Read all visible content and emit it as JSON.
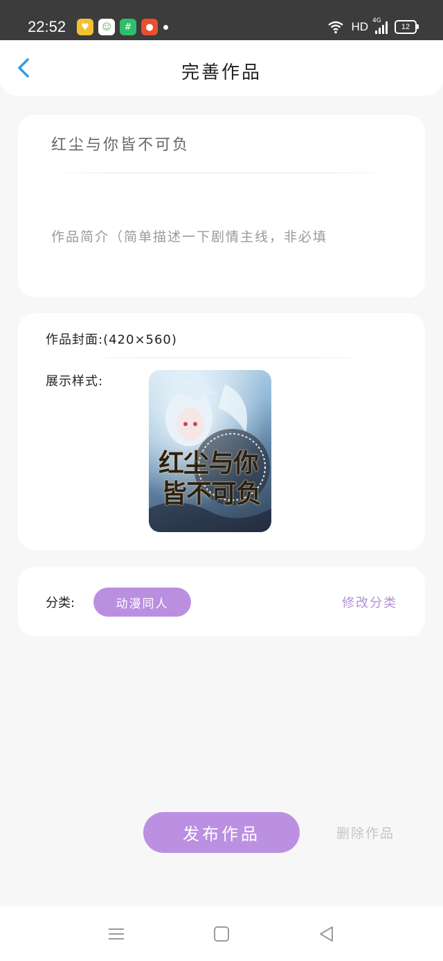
{
  "status_bar": {
    "time": "22:52",
    "network": "HD",
    "cell": "4G",
    "battery": "12",
    "app_icons": [
      "notes-app-icon",
      "chat-app-icon",
      "shop-app-icon",
      "video-app-icon"
    ]
  },
  "header": {
    "title": "完善作品",
    "back_icon": "chevron-left-icon"
  },
  "work": {
    "title_value": "红尘与你皆不可负",
    "description_placeholder": "作品简介（简单描述一下剧情主线，非必填"
  },
  "cover": {
    "label": "作品封面:(420×560)",
    "style_label": "展示样式:",
    "cover_text_line1": "红尘与你",
    "cover_text_line2": "皆不可负"
  },
  "category": {
    "label": "分类:",
    "selected": "动漫同人",
    "edit_label": "修改分类"
  },
  "actions": {
    "publish_label": "发布作品",
    "delete_label": "删除作品"
  },
  "nav_bar": {
    "icons": [
      "menu-icon",
      "home-square-icon",
      "back-triangle-icon"
    ]
  },
  "colors": {
    "accent": "#bb90e2",
    "back_icon": "#2e9be6",
    "background": "#f7f7f7"
  }
}
